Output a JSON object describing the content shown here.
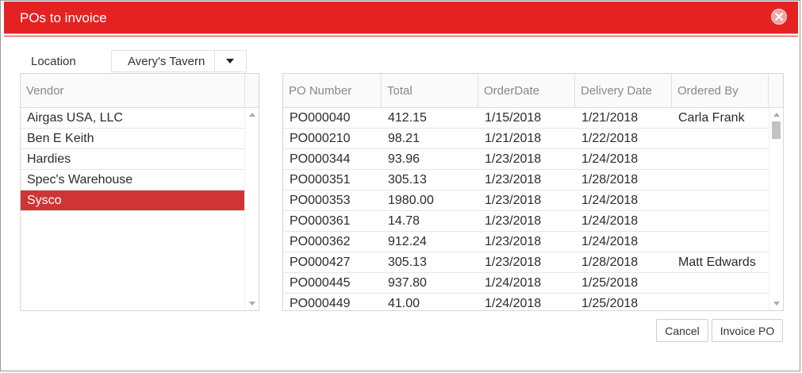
{
  "dialog": {
    "title": "POs to invoice",
    "close_icon": "close-icon"
  },
  "location": {
    "label": "Location",
    "value": "Avery's Tavern"
  },
  "vendors": {
    "header": "Vendor",
    "items": [
      "Airgas USA, LLC",
      "Ben E Keith",
      "Hardies",
      "Spec's Warehouse",
      "Sysco"
    ],
    "selected_index": 4
  },
  "pos": {
    "headers": {
      "po_number": "PO Number",
      "total": "Total",
      "order_date": "OrderDate",
      "delivery_date": "Delivery Date",
      "ordered_by": "Ordered By"
    },
    "rows": [
      {
        "po": "PO000040",
        "total": "412.15",
        "order": "1/15/2018",
        "delivery": "1/21/2018",
        "by": "Carla Frank"
      },
      {
        "po": "PO000210",
        "total": "98.21",
        "order": "1/21/2018",
        "delivery": "1/22/2018",
        "by": ""
      },
      {
        "po": "PO000344",
        "total": "93.96",
        "order": "1/23/2018",
        "delivery": "1/24/2018",
        "by": ""
      },
      {
        "po": "PO000351",
        "total": "305.13",
        "order": "1/23/2018",
        "delivery": "1/28/2018",
        "by": ""
      },
      {
        "po": "PO000353",
        "total": "1980.00",
        "order": "1/23/2018",
        "delivery": "1/24/2018",
        "by": ""
      },
      {
        "po": "PO000361",
        "total": "14.78",
        "order": "1/23/2018",
        "delivery": "1/24/2018",
        "by": ""
      },
      {
        "po": "PO000362",
        "total": "912.24",
        "order": "1/23/2018",
        "delivery": "1/24/2018",
        "by": ""
      },
      {
        "po": "PO000427",
        "total": "305.13",
        "order": "1/23/2018",
        "delivery": "1/28/2018",
        "by": "Matt Edwards"
      },
      {
        "po": "PO000445",
        "total": "937.80",
        "order": "1/24/2018",
        "delivery": "1/25/2018",
        "by": ""
      },
      {
        "po": "PO000449",
        "total": "41.00",
        "order": "1/24/2018",
        "delivery": "1/25/2018",
        "by": ""
      }
    ]
  },
  "buttons": {
    "cancel": "Cancel",
    "invoice": "Invoice PO"
  },
  "colors": {
    "title_bar": "#e52222",
    "selected_row": "#cf3535"
  }
}
